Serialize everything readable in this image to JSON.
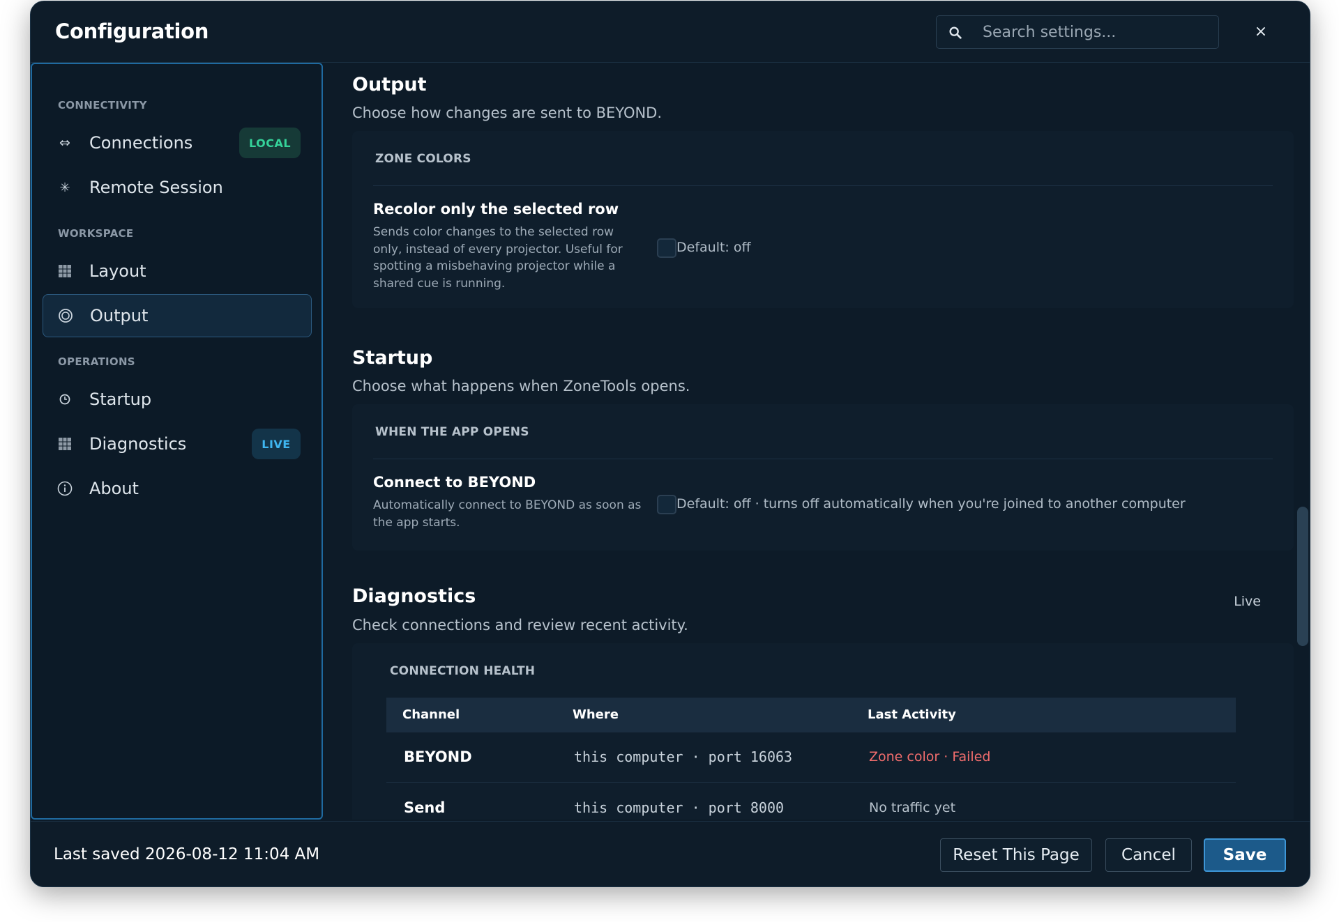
{
  "header": {
    "title": "Configuration",
    "search_placeholder": "Search settings...",
    "close_label": "×"
  },
  "sidebar": {
    "sections": [
      {
        "label": "CONNECTIVITY"
      },
      {
        "label": "WORKSPACE"
      },
      {
        "label": "OPERATIONS"
      }
    ],
    "items": [
      {
        "label": "Connections",
        "icon": "arrows-left-right-icon",
        "badge": "LOCAL"
      },
      {
        "label": "Remote Session",
        "icon": "asterisk-icon"
      },
      {
        "label": "Layout",
        "icon": "grid-icon"
      },
      {
        "label": "Output",
        "icon": "radio-target-icon",
        "active": true
      },
      {
        "label": "Startup",
        "icon": "clock-icon"
      },
      {
        "label": "Diagnostics",
        "icon": "grid-icon",
        "badge": "LIVE"
      },
      {
        "label": "About",
        "icon": "info-icon"
      }
    ]
  },
  "output": {
    "title": "Output",
    "subtitle": "Choose how changes are sent to BEYOND.",
    "card_heading": "ZONE COLORS",
    "option_title": "Recolor only the selected row",
    "option_desc": "Sends color changes to the selected row only, instead of every projector. Useful for spotting a misbehaving projector while a shared cue is running.",
    "option_default": "Default: off",
    "option_checked": false
  },
  "startup": {
    "title": "Startup",
    "subtitle": "Choose what happens when ZoneTools opens.",
    "card_heading": "WHEN THE APP OPENS",
    "option_title": "Connect to BEYOND",
    "option_desc": "Automatically connect to BEYOND as soon as the app starts.",
    "option_default": "Default: off · turns off automatically when you're joined to another computer",
    "option_checked": false
  },
  "diagnostics": {
    "title": "Diagnostics",
    "subtitle": "Check connections and review recent activity.",
    "live_label": "Live",
    "card_heading": "CONNECTION HEALTH",
    "columns": [
      "Channel",
      "Where",
      "Last Activity"
    ],
    "rows": [
      {
        "channel": "BEYOND",
        "where": "this computer · port 16063",
        "activity": "Zone color · Failed",
        "status": "error"
      },
      {
        "channel": "Send",
        "where": "this computer · port 8000",
        "activity": "No traffic yet",
        "status": "idle"
      }
    ]
  },
  "footer": {
    "last_saved": "Last saved 2026-08-12 11:04 AM",
    "reset_label": "Reset This Page",
    "cancel_label": "Cancel",
    "save_label": "Save"
  },
  "colors": {
    "accent": "#3e96d6",
    "local_badge": "#35d39a",
    "live_badge": "#3fb6f0",
    "error": "#f26d6d",
    "idle": "#b7c2cc"
  }
}
